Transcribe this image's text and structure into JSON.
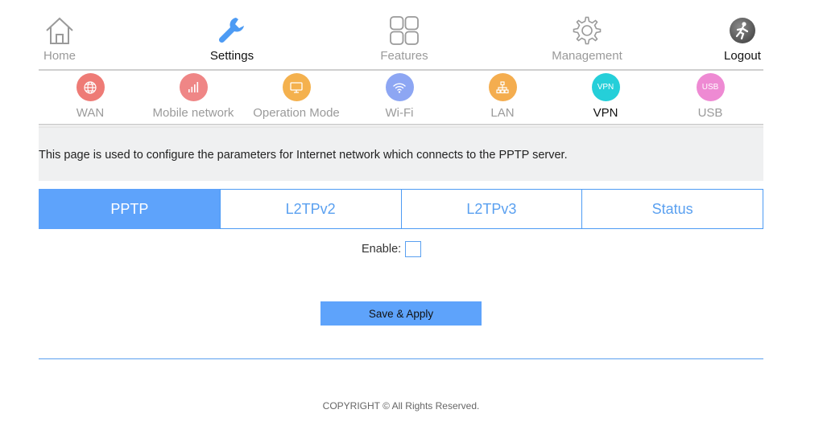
{
  "top_nav": {
    "items": [
      {
        "label": "Home",
        "icon": "home-icon"
      },
      {
        "label": "Settings",
        "icon": "wrench-icon",
        "active": true
      },
      {
        "label": "Features",
        "icon": "grid-icon"
      },
      {
        "label": "Management",
        "icon": "gear-icon"
      },
      {
        "label": "Logout",
        "icon": "logout-icon"
      }
    ]
  },
  "sub_nav": {
    "items": [
      {
        "label": "WAN",
        "icon": "globe-icon",
        "color": "#ee7b76"
      },
      {
        "label": "Mobile network",
        "icon": "signal-bars-icon",
        "color": "#ef8686"
      },
      {
        "label": "Operation Mode",
        "icon": "monitor-icon",
        "color": "#f4b14e"
      },
      {
        "label": "Wi-Fi",
        "icon": "wifi-icon",
        "color": "#8da6f3"
      },
      {
        "label": "LAN",
        "icon": "network-tree-icon",
        "color": "#f4ad4f"
      },
      {
        "label": "VPN",
        "icon_text": "VPN",
        "color": "#25cfd9",
        "active": true
      },
      {
        "label": "USB",
        "icon_text": "USB",
        "color": "#ee8ad3"
      }
    ]
  },
  "description": "This page is used to configure the parameters for Internet network which connects to the PPTP server.",
  "tabs": [
    {
      "label": "PPTP",
      "active": true
    },
    {
      "label": "L2TPv2"
    },
    {
      "label": "L2TPv3"
    },
    {
      "label": "Status"
    }
  ],
  "form": {
    "enable_label": "Enable:",
    "enable_checked": false
  },
  "save_button": "Save & Apply",
  "copyright": "COPYRIGHT © All Rights Reserved.",
  "colors": {
    "accent": "#5ea3fb",
    "tab_text": "#5aa0f0",
    "muted_text": "#9a9a9a"
  }
}
